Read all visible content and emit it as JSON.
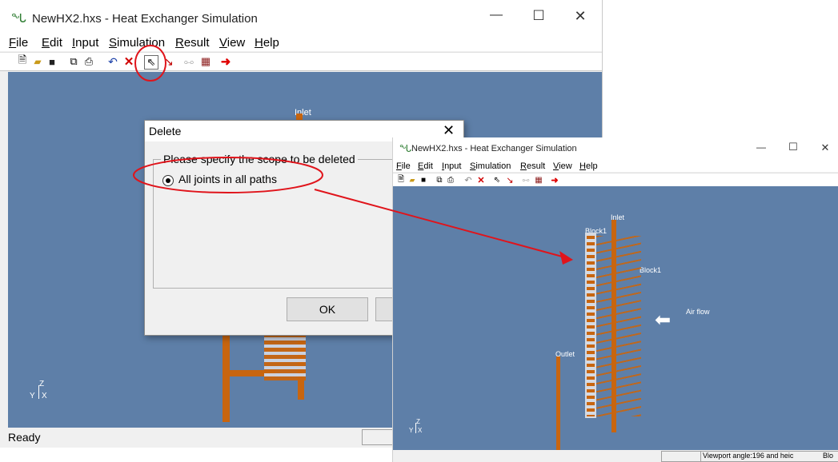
{
  "main_window": {
    "title": "NewHX2.hxs - Heat Exchanger Simulation",
    "menu": [
      "File",
      "Edit",
      "Input",
      "Simulation",
      "Result",
      "View",
      "Help"
    ],
    "menu_underline": [
      "F",
      "E",
      "I",
      "S",
      "R",
      "V",
      "H"
    ],
    "status": "Ready",
    "labels": {
      "inlet": "Inlet"
    },
    "axis": {
      "z": "Z",
      "y": "Y",
      "x": "X"
    }
  },
  "dialog": {
    "title": "Delete",
    "group_label": "Please specify the scope to be deleted",
    "option": "All joints in all paths",
    "ok": "OK"
  },
  "inset_window": {
    "title": "NewHX2.hxs - Heat Exchanger Simulation",
    "menu": [
      "File",
      "Edit",
      "Input",
      "Simulation",
      "Result",
      "View",
      "Help"
    ],
    "labels": {
      "inlet": "Inlet",
      "block1_top": "Block1",
      "block1_side": "Block1",
      "air_flow": "Air flow",
      "outlet": "Outlet"
    },
    "status": "Viewport angle:196 and heic",
    "status_extra": "Blo",
    "axis": {
      "z": "Z",
      "y": "Y",
      "x": "X"
    }
  },
  "colors": {
    "viewport": "#5e7fa8",
    "pipe": "#c8650f",
    "annotation": "#e0141b"
  }
}
